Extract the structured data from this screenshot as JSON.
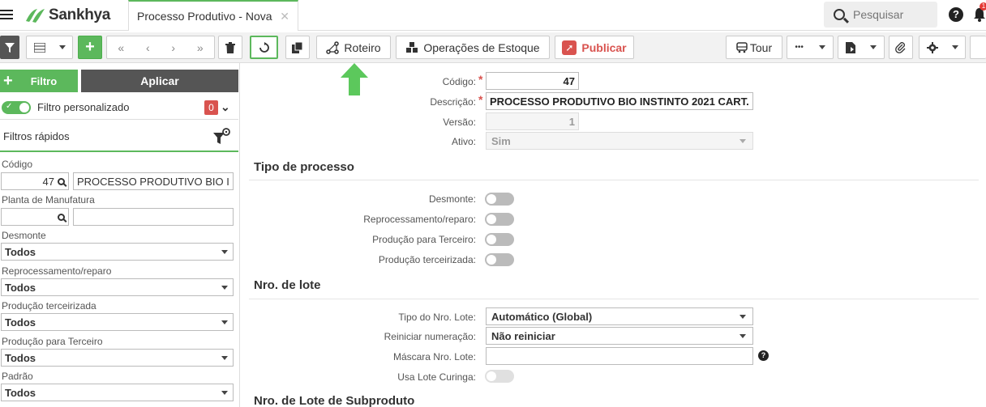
{
  "header": {
    "app_name": "Sankhya",
    "tab_title": "Processo Produtivo - Nova",
    "tab_close": "✕",
    "search_placeholder": "Pesquisar",
    "help_glyph": "?",
    "notification_count": "1"
  },
  "toolbar": {
    "roteiro_label": "Roteiro",
    "operacoes_label": "Operações de Estoque",
    "publicar_label": "Publicar",
    "tour_label": "Tour",
    "more_label": "•••"
  },
  "sidebar": {
    "filtro_label": "Filtro",
    "aplicar_label": "Aplicar",
    "custom_filter_label": "Filtro personalizado",
    "custom_filter_count": "0",
    "quick_filters_title": "Filtros rápidos",
    "fields": {
      "codigo_label": "Código",
      "codigo_value": "47",
      "codigo_desc": "PROCESSO PRODUTIVO BIO I",
      "planta_label": "Planta de Manufatura",
      "planta_value": "",
      "planta_desc": "",
      "desmonte_label": "Desmonte",
      "desmonte_value": "Todos",
      "reprocessamento_label": "Reprocessamento/reparo",
      "reprocessamento_value": "Todos",
      "terceirizada_label": "Produção terceirizada",
      "terceirizada_value": "Todos",
      "para_terceiro_label": "Produção para Terceiro",
      "para_terceiro_value": "Todos",
      "padrao_label": "Padrão",
      "padrao_value": "Todos"
    }
  },
  "form": {
    "codigo_label": "Código:",
    "codigo_value": "47",
    "descricao_label": "Descrição:",
    "descricao_value": "PROCESSO PRODUTIVO BIO INSTINTO 2021 CART.",
    "versao_label": "Versão:",
    "versao_value": "1",
    "ativo_label": "Ativo:",
    "ativo_value": "Sim",
    "required_mark": "*",
    "tipo_processo_title": "Tipo de processo",
    "desmonte_label": "Desmonte:",
    "reprocessamento_label": "Reprocessamento/reparo:",
    "para_terceiro_label": "Produção para Terceiro:",
    "terceirizada_label": "Produção terceirizada:",
    "lote_title": "Nro. de lote",
    "tipo_lote_label": "Tipo do Nro. Lote:",
    "tipo_lote_value": "Automático (Global)",
    "reiniciar_label": "Reiniciar numeração:",
    "reiniciar_value": "Não reiniciar",
    "mascara_label": "Máscara Nro. Lote:",
    "mascara_value": "",
    "curinga_label": "Usa Lote Curinga:",
    "subproduto_title": "Nro. de Lote de Subproduto"
  },
  "colors": {
    "accent_green": "#5cb85c",
    "danger_red": "#d9534f",
    "dark_gray": "#555555"
  }
}
